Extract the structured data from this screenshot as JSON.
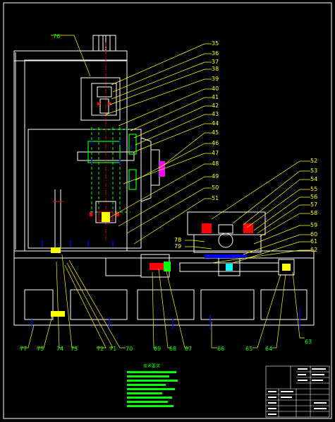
{
  "drawing": {
    "colors": {
      "background": "#000000",
      "outline": "#ffffff",
      "leader_yellow": "#ffff00",
      "leader_green": "#00ff00",
      "hidden_line": "#00ff00",
      "blue_marks": "#0000ff",
      "red_marks": "#ff0000",
      "magenta_part": "#ff00ff",
      "cyan_part": "#00ffff"
    },
    "callouts_top": {
      "c76": "76",
      "c35": "35",
      "c36": "36",
      "c37": "37",
      "c38": "38",
      "c39": "39",
      "c40": "40",
      "c41": "41",
      "c42": "42",
      "c43": "43",
      "c44": "44",
      "c45": "45",
      "c46": "46",
      "c47": "47",
      "c48": "48",
      "c49": "49",
      "c50": "50",
      "c51": "51"
    },
    "callouts_right": {
      "c52": "52",
      "c53": "53",
      "c54": "54",
      "c55": "55",
      "c56": "56",
      "c57": "57",
      "c58": "58",
      "c59": "59",
      "c60": "60",
      "c61": "61",
      "c62": "62",
      "c78": "78",
      "c79": "79"
    },
    "callouts_bottom": {
      "c77": "77",
      "c75": "75",
      "c74": "74",
      "c73": "73",
      "c72": "72",
      "c71": "71",
      "c70": "70",
      "c69": "69",
      "c68": "68",
      "c67": "67",
      "c66": "66",
      "c65": "65",
      "c64": "64",
      "c63": "63"
    },
    "notes_title": "技术要求"
  }
}
